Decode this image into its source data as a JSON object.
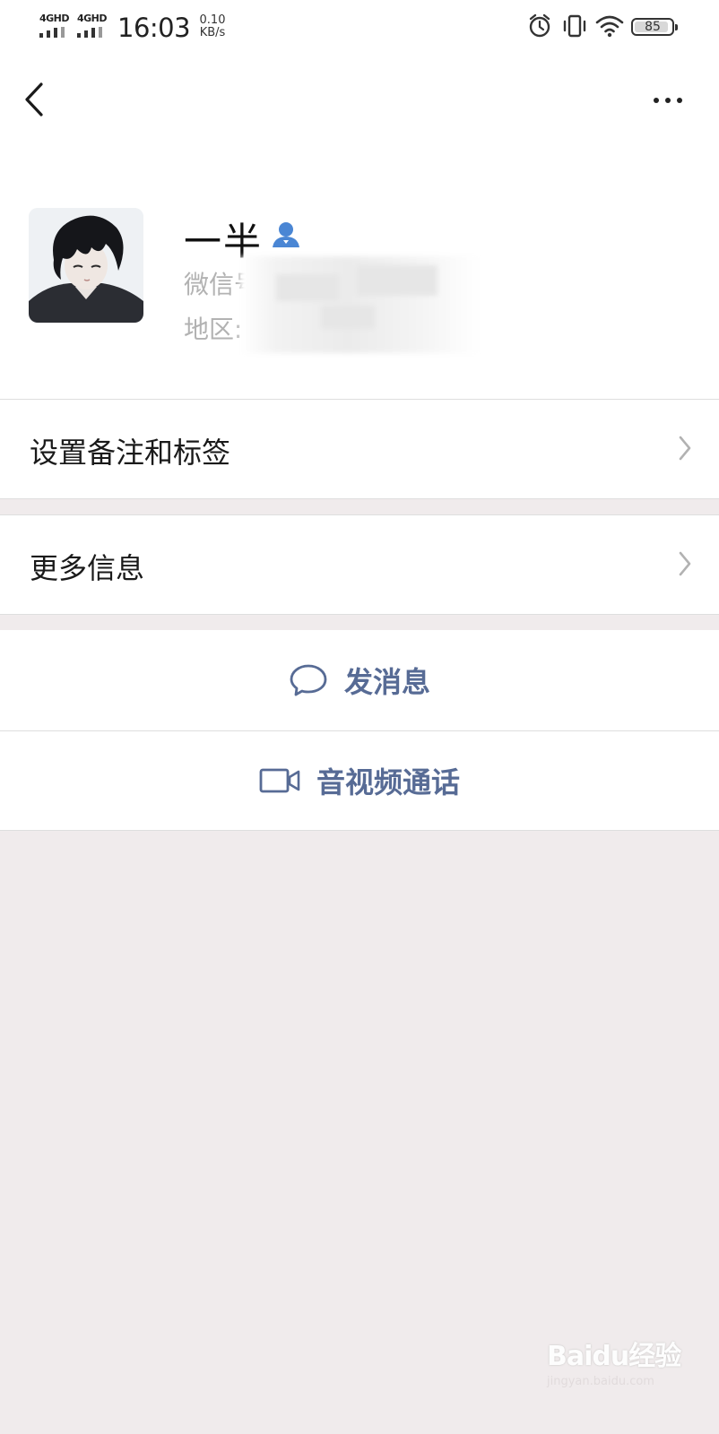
{
  "status_bar": {
    "sim1": "4GHD",
    "sim2": "4GHD",
    "time": "16:03",
    "speed_value": "0.10",
    "speed_unit": "KB/s",
    "battery": "85",
    "icons": [
      "alarm-icon",
      "vibrate-icon",
      "wifi-icon",
      "battery-icon"
    ]
  },
  "nav": {
    "back_icon": "chevron-left-icon",
    "more_icon": "more-dots-icon"
  },
  "profile": {
    "name": "一半",
    "wechat_id_label": "微信号",
    "region_label": "地区:"
  },
  "menu": {
    "remark_label": "设置备注和标签",
    "more_info_label": "更多信息"
  },
  "actions": {
    "message_label": "发消息",
    "call_label": "音视频通话"
  },
  "watermark": {
    "brand": "Baidu经验",
    "url": "jingyan.baidu.com"
  },
  "colors": {
    "link": "#576b95",
    "verified_icon": "#4a86d4",
    "background": "#f0ebec"
  }
}
